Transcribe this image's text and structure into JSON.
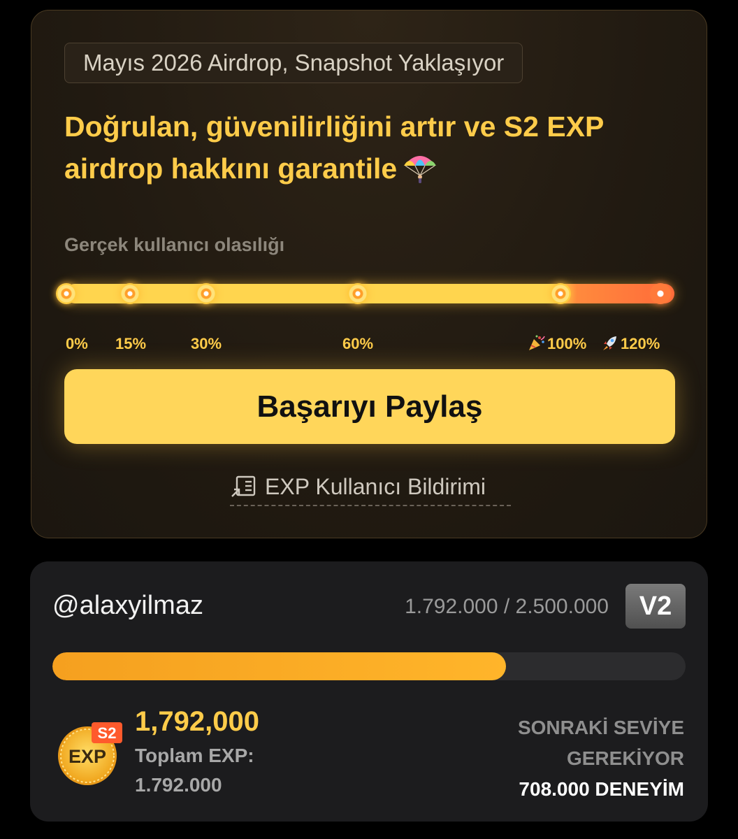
{
  "airdrop": {
    "badge": "Mayıs 2026 Airdrop, Snapshot Yaklaşıyor",
    "headline": "Doğrulan, güvenilirliğini artır ve S2 EXP airdrop hakkını garantile",
    "probability_label": "Gerçek kullanıcı olasılığı",
    "probability_value": 120,
    "milestones": [
      "0%",
      "15%",
      "30%",
      "60%",
      "100%",
      "120%"
    ],
    "share_button": "Başarıyı Paylaş",
    "report_link": "EXP Kullanıcı Bildirimi",
    "colors": {
      "accent": "#ffcc4a",
      "button": "#ffd65a",
      "over_track": "#ff6a3a"
    }
  },
  "profile": {
    "username": "@alaxyilmaz",
    "progress_text": "1.792.000 / 2.500.000",
    "level_badge": "V2",
    "progress_fraction": 0.7168,
    "coin": {
      "season": "S2",
      "label": "EXP"
    },
    "exp_value": "1,792,000",
    "total_label": "Toplam EXP:",
    "total_value": "1.792.000",
    "next_level_line1": "SONRAKİ SEVİYE",
    "next_level_line2": "GEREKİYOR",
    "next_level_required": "708.000 DENEYİM",
    "colors": {
      "bar": "#f5a01f",
      "badge": "#606060"
    }
  }
}
